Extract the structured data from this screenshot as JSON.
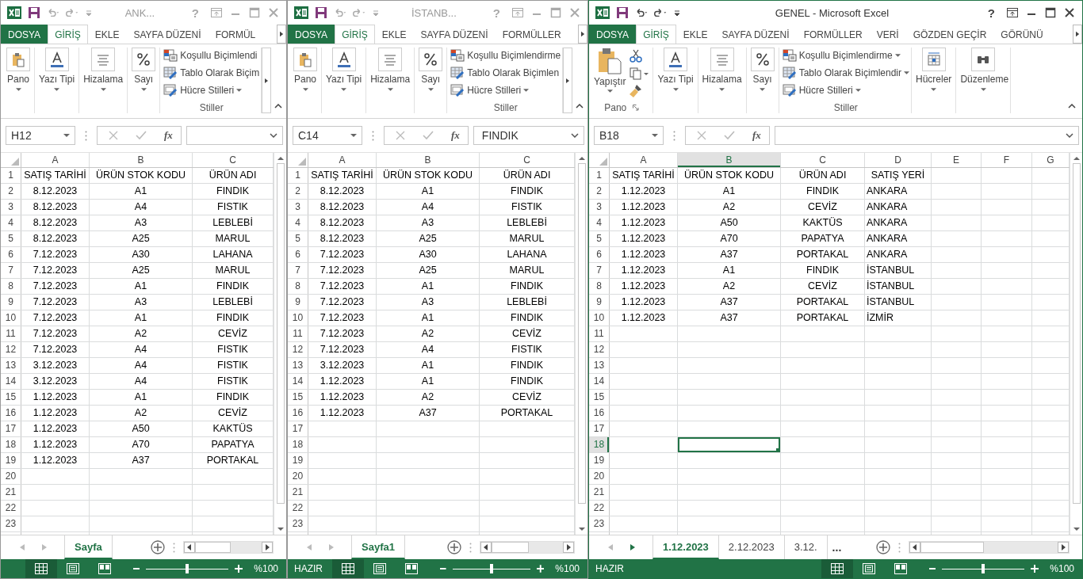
{
  "windows": [
    {
      "title": "ANK...",
      "active": false,
      "help": "?",
      "fx": "fx",
      "name_box": "H12",
      "ribbon_overflow": true,
      "sheet_nav_forward": false,
      "zoom": {
        "label": "%100",
        "level": 0.5
      },
      "menu_tabs": [
        {
          "label": "DOSYA",
          "kind": "file",
          "selected": false
        },
        {
          "label": "GİRİŞ",
          "kind": "tab",
          "selected": true
        },
        {
          "label": "EKLE",
          "kind": "tab",
          "selected": false
        },
        {
          "label": "SAYFA DÜZENİ",
          "kind": "tab",
          "selected": false
        },
        {
          "label": "FORMÜL",
          "kind": "tab",
          "selected": false
        }
      ],
      "ribbon": [
        {
          "kind": "pano",
          "label": "Pano"
        },
        {
          "kind": "font",
          "label": "Yazı Tipi"
        },
        {
          "kind": "align",
          "label": "Hizalama"
        },
        {
          "kind": "number",
          "label": "Sayı"
        },
        {
          "kind": "styles",
          "group_label": "Stiller",
          "items": [
            {
              "label": "Koşullu Biçimlendi",
              "dropdown": false
            },
            {
              "label": "Tablo Olarak Biçim",
              "dropdown": false
            },
            {
              "label": "Hücre Stilleri",
              "dropdown": true
            }
          ]
        }
      ],
      "columns": [
        {
          "label": "A",
          "selected": false
        },
        {
          "label": "B",
          "selected": false
        },
        {
          "label": "C",
          "selected": false
        }
      ],
      "rows": [
        {
          "number": "1",
          "selected": false,
          "cells": [
            "SATIŞ TARİHİ",
            "ÜRÜN STOK KODU",
            "ÜRÜN ADI"
          ]
        },
        {
          "number": "2",
          "selected": false,
          "cells": [
            "8.12.2023",
            "A1",
            "FINDIK"
          ]
        },
        {
          "number": "3",
          "selected": false,
          "cells": [
            "8.12.2023",
            "A4",
            "FISTIK"
          ]
        },
        {
          "number": "4",
          "selected": false,
          "cells": [
            "8.12.2023",
            "A3",
            "LEBLEBİ"
          ]
        },
        {
          "number": "5",
          "selected": false,
          "cells": [
            "8.12.2023",
            "A25",
            "MARUL"
          ]
        },
        {
          "number": "6",
          "selected": false,
          "cells": [
            "7.12.2023",
            "A30",
            "LAHANA"
          ]
        },
        {
          "number": "7",
          "selected": false,
          "cells": [
            "7.12.2023",
            "A25",
            "MARUL"
          ]
        },
        {
          "number": "8",
          "selected": false,
          "cells": [
            "7.12.2023",
            "A1",
            "FINDIK"
          ]
        },
        {
          "number": "9",
          "selected": false,
          "cells": [
            "7.12.2023",
            "A3",
            "LEBLEBİ"
          ]
        },
        {
          "number": "10",
          "selected": false,
          "cells": [
            "7.12.2023",
            "A1",
            "FINDIK"
          ]
        },
        {
          "number": "11",
          "selected": false,
          "cells": [
            "7.12.2023",
            "A2",
            "CEVİZ"
          ]
        },
        {
          "number": "12",
          "selected": false,
          "cells": [
            "7.12.2023",
            "A4",
            "FISTIK"
          ]
        },
        {
          "number": "13",
          "selected": false,
          "cells": [
            "3.12.2023",
            "A4",
            "FISTIK"
          ]
        },
        {
          "number": "14",
          "selected": false,
          "cells": [
            "3.12.2023",
            "A4",
            "FISTIK"
          ]
        },
        {
          "number": "15",
          "selected": false,
          "cells": [
            "1.12.2023",
            "A1",
            "FINDIK"
          ]
        },
        {
          "number": "16",
          "selected": false,
          "cells": [
            "1.12.2023",
            "A2",
            "CEVİZ"
          ]
        },
        {
          "number": "17",
          "selected": false,
          "cells": [
            "1.12.2023",
            "A50",
            "KAKTÜS"
          ]
        },
        {
          "number": "18",
          "selected": false,
          "cells": [
            "1.12.2023",
            "A70",
            "PAPATYA"
          ]
        },
        {
          "number": "19",
          "selected": false,
          "cells": [
            "1.12.2023",
            "A37",
            "PORTAKAL"
          ]
        },
        {
          "number": "20",
          "selected": false
        },
        {
          "number": "21",
          "selected": false
        },
        {
          "number": "22",
          "selected": false
        },
        {
          "number": "23",
          "selected": false
        }
      ],
      "sheets": [
        {
          "label": "Sayfa",
          "selected": true
        }
      ],
      "views": [
        {
          "kind": "normal",
          "selected": true
        },
        {
          "kind": "page_layout",
          "selected": false
        },
        {
          "kind": "page_break",
          "selected": false
        }
      ]
    },
    {
      "title": "İSTANB...",
      "active": false,
      "help": "?",
      "fx": "fx",
      "name_box": "C14",
      "formula": "FINDIK",
      "ribbon_overflow": true,
      "sheet_nav_forward": false,
      "status": "HAZIR",
      "zoom": {
        "label": "%100",
        "level": 0.5
      },
      "menu_tabs": [
        {
          "label": "DOSYA",
          "kind": "file",
          "selected": false
        },
        {
          "label": "GİRİŞ",
          "kind": "tab",
          "selected": true
        },
        {
          "label": "EKLE",
          "kind": "tab",
          "selected": false
        },
        {
          "label": "SAYFA DÜZENİ",
          "kind": "tab",
          "selected": false
        },
        {
          "label": "FORMÜLLER",
          "kind": "tab",
          "selected": false
        }
      ],
      "ribbon": [
        {
          "kind": "pano",
          "label": "Pano"
        },
        {
          "kind": "font",
          "label": "Yazı Tipi"
        },
        {
          "kind": "align",
          "label": "Hizalama"
        },
        {
          "kind": "number",
          "label": "Sayı"
        },
        {
          "kind": "styles",
          "group_label": "Stiller",
          "items": [
            {
              "label": "Koşullu Biçimlendirme",
              "dropdown": false
            },
            {
              "label": "Tablo Olarak Biçimlen",
              "dropdown": false
            },
            {
              "label": "Hücre Stilleri",
              "dropdown": true
            }
          ]
        }
      ],
      "columns": [
        {
          "label": "A",
          "selected": false
        },
        {
          "label": "B",
          "selected": false
        },
        {
          "label": "C",
          "selected": false
        }
      ],
      "rows": [
        {
          "number": "1",
          "selected": false,
          "cells": [
            "SATIŞ TARİHİ",
            "ÜRÜN STOK KODU",
            "ÜRÜN ADI"
          ]
        },
        {
          "number": "2",
          "selected": false,
          "cells": [
            "8.12.2023",
            "A1",
            "FINDIK"
          ]
        },
        {
          "number": "3",
          "selected": false,
          "cells": [
            "8.12.2023",
            "A4",
            "FISTIK"
          ]
        },
        {
          "number": "4",
          "selected": false,
          "cells": [
            "8.12.2023",
            "A3",
            "LEBLEBİ"
          ]
        },
        {
          "number": "5",
          "selected": false,
          "cells": [
            "8.12.2023",
            "A25",
            "MARUL"
          ]
        },
        {
          "number": "6",
          "selected": false,
          "cells": [
            "7.12.2023",
            "A30",
            "LAHANA"
          ]
        },
        {
          "number": "7",
          "selected": false,
          "cells": [
            "7.12.2023",
            "A25",
            "MARUL"
          ]
        },
        {
          "number": "8",
          "selected": false,
          "cells": [
            "7.12.2023",
            "A1",
            "FINDIK"
          ]
        },
        {
          "number": "9",
          "selected": false,
          "cells": [
            "7.12.2023",
            "A3",
            "LEBLEBİ"
          ]
        },
        {
          "number": "10",
          "selected": false,
          "cells": [
            "7.12.2023",
            "A1",
            "FINDIK"
          ]
        },
        {
          "number": "11",
          "selected": false,
          "cells": [
            "7.12.2023",
            "A2",
            "CEVİZ"
          ]
        },
        {
          "number": "12",
          "selected": false,
          "cells": [
            "7.12.2023",
            "A4",
            "FISTIK"
          ]
        },
        {
          "number": "13",
          "selected": false,
          "cells": [
            "3.12.2023",
            "A1",
            "FINDIK"
          ]
        },
        {
          "number": "14",
          "selected": false,
          "cells": [
            "1.12.2023",
            "A1",
            "FINDIK"
          ]
        },
        {
          "number": "15",
          "selected": false,
          "cells": [
            "1.12.2023",
            "A2",
            "CEVİZ"
          ]
        },
        {
          "number": "16",
          "selected": false,
          "cells": [
            "1.12.2023",
            "A37",
            "PORTAKAL"
          ]
        },
        {
          "number": "17",
          "selected": false
        },
        {
          "number": "18",
          "selected": false
        },
        {
          "number": "19",
          "selected": false
        },
        {
          "number": "20",
          "selected": false
        },
        {
          "number": "21",
          "selected": false
        },
        {
          "number": "22",
          "selected": false
        },
        {
          "number": "23",
          "selected": false
        }
      ],
      "sheets": [
        {
          "label": "Sayfa1",
          "selected": true
        }
      ],
      "views": [
        {
          "kind": "normal",
          "selected": true
        },
        {
          "kind": "page_layout",
          "selected": false
        },
        {
          "kind": "page_break",
          "selected": false
        }
      ]
    },
    {
      "title": "GENEL - Microsoft Excel",
      "active": true,
      "help": "?",
      "fx": "fx",
      "name_box": "B18",
      "ribbon_overflow": false,
      "sheet_nav_forward": true,
      "status": "HAZIR",
      "zoom": {
        "label": "%100",
        "level": 0.5
      },
      "menu_tabs": [
        {
          "label": "DOSYA",
          "kind": "file",
          "selected": false
        },
        {
          "label": "GİRİŞ",
          "kind": "tab",
          "selected": true
        },
        {
          "label": "EKLE",
          "kind": "tab",
          "selected": false
        },
        {
          "label": "SAYFA DÜZENİ",
          "kind": "tab",
          "selected": false
        },
        {
          "label": "FORMÜLLER",
          "kind": "tab",
          "selected": false
        },
        {
          "label": "VERİ",
          "kind": "tab",
          "selected": false
        },
        {
          "label": "GÖZDEN GEÇİR",
          "kind": "tab",
          "selected": false
        },
        {
          "label": "GÖRÜNÜ",
          "kind": "tab",
          "selected": false
        }
      ],
      "ribbon": [
        {
          "kind": "paste",
          "label": "Yapıştır",
          "group_label": "Pano"
        },
        {
          "kind": "font",
          "label": "Yazı Tipi"
        },
        {
          "kind": "align",
          "label": "Hizalama"
        },
        {
          "kind": "number",
          "label": "Sayı"
        },
        {
          "kind": "styles",
          "group_label": "Stiller",
          "items": [
            {
              "label": "Koşullu Biçimlendirme",
              "dropdown": true
            },
            {
              "label": "Tablo Olarak Biçimlendir",
              "dropdown": true
            },
            {
              "label": "Hücre Stilleri",
              "dropdown": true
            }
          ]
        },
        {
          "kind": "cells",
          "label": "Hücreler"
        },
        {
          "kind": "editing",
          "label": "Düzenleme"
        }
      ],
      "columns": [
        {
          "label": "A",
          "selected": false
        },
        {
          "label": "B",
          "selected": true
        },
        {
          "label": "C",
          "selected": false
        },
        {
          "label": "D",
          "selected": false
        },
        {
          "label": "E",
          "selected": false
        },
        {
          "label": "F",
          "selected": false
        },
        {
          "label": "G",
          "selected": false
        }
      ],
      "rows": [
        {
          "number": "1",
          "selected": false,
          "cells": [
            "SATIŞ TARİHİ",
            "ÜRÜN STOK KODU",
            "ÜRÜN ADI",
            "SATIŞ YERİ"
          ]
        },
        {
          "number": "2",
          "selected": false,
          "cells": [
            "1.12.2023",
            "A1",
            "FINDIK",
            "ANKARA"
          ]
        },
        {
          "number": "3",
          "selected": false,
          "cells": [
            "1.12.2023",
            "A2",
            "CEVİZ",
            "ANKARA"
          ]
        },
        {
          "number": "4",
          "selected": false,
          "cells": [
            "1.12.2023",
            "A50",
            "KAKTÜS",
            "ANKARA"
          ]
        },
        {
          "number": "5",
          "selected": false,
          "cells": [
            "1.12.2023",
            "A70",
            "PAPATYA",
            "ANKARA"
          ]
        },
        {
          "number": "6",
          "selected": false,
          "cells": [
            "1.12.2023",
            "A37",
            "PORTAKAL",
            "ANKARA"
          ]
        },
        {
          "number": "7",
          "selected": false,
          "cells": [
            "1.12.2023",
            "A1",
            "FINDIK",
            "İSTANBUL"
          ]
        },
        {
          "number": "8",
          "selected": false,
          "cells": [
            "1.12.2023",
            "A2",
            "CEVİZ",
            "İSTANBUL"
          ]
        },
        {
          "number": "9",
          "selected": false,
          "cells": [
            "1.12.2023",
            "A37",
            "PORTAKAL",
            "İSTANBUL"
          ]
        },
        {
          "number": "10",
          "selected": false,
          "cells": [
            "1.12.2023",
            "A37",
            "PORTAKAL",
            "İZMİR"
          ]
        },
        {
          "number": "11",
          "selected": false
        },
        {
          "number": "12",
          "selected": false
        },
        {
          "number": "13",
          "selected": false
        },
        {
          "number": "14",
          "selected": false
        },
        {
          "number": "15",
          "selected": false
        },
        {
          "number": "16",
          "selected": false
        },
        {
          "number": "17",
          "selected": false
        },
        {
          "number": "18",
          "selected": true
        },
        {
          "number": "19",
          "selected": false
        },
        {
          "number": "20",
          "selected": false
        },
        {
          "number": "21",
          "selected": false
        },
        {
          "number": "22",
          "selected": false
        },
        {
          "number": "23",
          "selected": false
        }
      ],
      "sheets": [
        {
          "label": "1.12.2023",
          "selected": true
        },
        {
          "label": "2.12.2023",
          "selected": false
        },
        {
          "label": "3.12.",
          "selected": false
        }
      ],
      "sheet_overflow": "...",
      "views": [
        {
          "kind": "normal",
          "selected": true
        },
        {
          "kind": "page_layout",
          "selected": false
        },
        {
          "kind": "page_break",
          "selected": false
        }
      ]
    }
  ]
}
